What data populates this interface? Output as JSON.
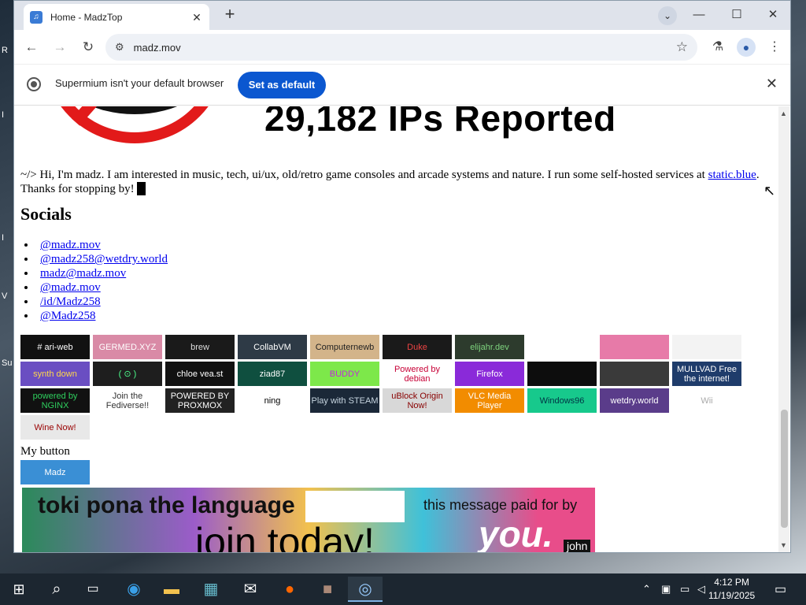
{
  "desktop": {
    "edge_letters": [
      "R",
      "I",
      "I",
      "V",
      "Su"
    ]
  },
  "tab": {
    "title": "Home - MadzTop",
    "favicon": "music-note-icon",
    "close": "✕"
  },
  "window_controls": {
    "minimize": "—",
    "maximize": "☐",
    "close": "✕",
    "tab_search": "⌄",
    "new_tab": "+"
  },
  "toolbar": {
    "back": "←",
    "forward": "→",
    "reload": "↻",
    "url": "madz.mov",
    "site_info_icon": "⚙",
    "star": "☆",
    "labs_icon": "⚗",
    "profile_icon": "👤",
    "menu_icon": "⋮"
  },
  "infobar": {
    "text": "Supermium isn't your default browser",
    "button": "Set as default",
    "close": "✕"
  },
  "page": {
    "headline": "29,182 IPs Reported",
    "intro_text": "~/> Hi, I'm madz. I am interested in music, tech, ui/ux, old/retro game consoles and arcade systems and nature. I run some self-hosted services at ",
    "intro_link": "static.blue",
    "intro_tail": ". Thanks for stopping by! ",
    "socials_heading": "Socials",
    "socials": [
      "@madz.mov",
      "@madz258@wetdry.world",
      "madz@madz.mov",
      "@madz.mov",
      "/id/Madz258",
      "@Madz258"
    ],
    "my_button": "My button",
    "buttons_row1": [
      {
        "label": "# ari-web",
        "bg": "#111",
        "fg": "#fff"
      },
      {
        "label": "GERMED.XYZ",
        "bg": "#d98aa6",
        "fg": "#fff"
      },
      {
        "label": "brew",
        "bg": "#1a1a1a",
        "fg": "#ddd"
      },
      {
        "label": "CollabVM",
        "bg": "#2e3a46",
        "fg": "#fff"
      },
      {
        "label": "Computernewb",
        "bg": "#d3b48a",
        "fg": "#222"
      },
      {
        "label": "Duke",
        "bg": "#1a1a1a",
        "fg": "#e44"
      },
      {
        "label": "elijahr.dev",
        "bg": "#2d3b2d",
        "fg": "#7ed37e"
      },
      {
        "label": "",
        "bg": "#fff",
        "fg": "#000"
      },
      {
        "label": "",
        "bg": "#e77aa8",
        "fg": "#fff"
      },
      {
        "label": "",
        "bg": "#f3f3f3",
        "fg": "#999"
      }
    ],
    "buttons_row2": [
      {
        "label": "synth down",
        "bg": "#6a4ec2",
        "fg": "#ffd84a"
      },
      {
        "label": "( ⊙ )",
        "bg": "#1e1e1e",
        "fg": "#4cff8c"
      },
      {
        "label": "chloe vea.st",
        "bg": "#111",
        "fg": "#fff"
      },
      {
        "label": "ziad87",
        "bg": "#0f4f3f",
        "fg": "#fff"
      },
      {
        "label": "BUDDY",
        "bg": "#7de84a",
        "fg": "#c12ad9"
      },
      {
        "label": "Powered by debian",
        "bg": "#fff",
        "fg": "#c70036"
      },
      {
        "label": "Firefox",
        "bg": "#8a2ad9",
        "fg": "#fff"
      },
      {
        "label": "",
        "bg": "#0d0d0d",
        "fg": "#fff"
      },
      {
        "label": "",
        "bg": "#3a3a3a",
        "fg": "#fff"
      },
      {
        "label": "MULLVAD Free the internet!",
        "bg": "#1f3c6b",
        "fg": "#fff"
      }
    ],
    "buttons_row3": [
      {
        "label": "powered by NGINX",
        "bg": "#111",
        "fg": "#2fcf5e"
      },
      {
        "label": "Join the Fediverse!!",
        "bg": "#fff",
        "fg": "#333"
      },
      {
        "label": "POWERED BY PROXMOX",
        "bg": "#222",
        "fg": "#fff"
      },
      {
        "label": "ning",
        "bg": "#fff",
        "fg": "#000"
      },
      {
        "label": "Play with STEAM",
        "bg": "#1b2838",
        "fg": "#c7d5e0"
      },
      {
        "label": "uBlock Origin Now!",
        "bg": "#d8d8d8",
        "fg": "#800"
      },
      {
        "label": "VLC Media Player",
        "bg": "#f28c00",
        "fg": "#fff"
      },
      {
        "label": "Windows96",
        "bg": "#17c98c",
        "fg": "#034"
      },
      {
        "label": "wetdry.world",
        "bg": "#5a3c8a",
        "fg": "#fff"
      },
      {
        "label": "Wii",
        "bg": "#fff",
        "fg": "#aaa"
      }
    ],
    "buttons_row4": [
      {
        "label": "Wine Now!",
        "bg": "#e8e8e8",
        "fg": "#900"
      }
    ],
    "my_button_img": {
      "label": "Madz",
      "bg": "#3a8fd5",
      "fg": "#fff"
    },
    "banner": {
      "line1": "toki pona the language",
      "line2": "join today!",
      "line3": "this message paid for by",
      "line4": "you.",
      "line5": "john"
    }
  },
  "taskbar": {
    "start_icon": "windows-logo-icon",
    "clock_time": "4:12 PM",
    "clock_date": "11/19/2025",
    "tray_up": "⌃"
  }
}
